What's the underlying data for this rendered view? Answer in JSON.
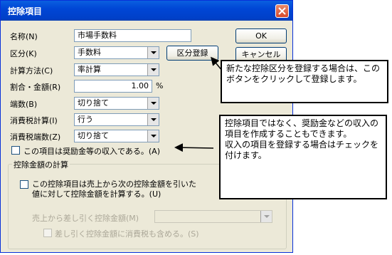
{
  "dialog": {
    "title": "控除項目",
    "name_label": "名称(N)",
    "name_value": "市場手数料",
    "category_label": "区分(K)",
    "category_value": "手数料",
    "register_category_button": "区分登録",
    "calc_method_label": "計算方法(C)",
    "calc_method_value": "率計算",
    "rate_label": "割合・金額(R)",
    "rate_value": "1.00",
    "rate_unit": "%",
    "rounding_label": "端数(B)",
    "rounding_value": "切り捨て",
    "consumption_tax_calc_label": "消費税計算(I)",
    "consumption_tax_calc_value": "行う",
    "consumption_tax_rounding_label": "消費税端数(Z)",
    "consumption_tax_rounding_value": "切り捨て",
    "income_item_checkbox_label": "この項目は奨励金等の収入である。(A)",
    "ok_button": "OK",
    "cancel_button": "キャンセル",
    "deduction_group_label": "控除金額の計算",
    "sales_deduction_checkbox_line1": "この控除項目は売上から次の控除金額を引いた",
    "sales_deduction_checkbox_line2": "値に対して控除金額を計算する。(U)",
    "deduct_from_sales_label": "売上から差し引く控除金額(M)",
    "include_tax_checkbox_label": "差し引く控除金額に消費税も含める。(S)"
  },
  "callouts": {
    "register_note": "新たな控除区分を登録する場合は、このボタンをクリックして登録します。",
    "income_note_line1": "控除項目ではなく、奨励金などの収入の項目を作成することもできます。",
    "income_note_line2": "収入の項目を登録する場合はチェックを付けます。"
  },
  "colors": {
    "titlebar": "#0046d5",
    "dialog_bg": "#ece9d8",
    "close_button": "#d6492b"
  }
}
